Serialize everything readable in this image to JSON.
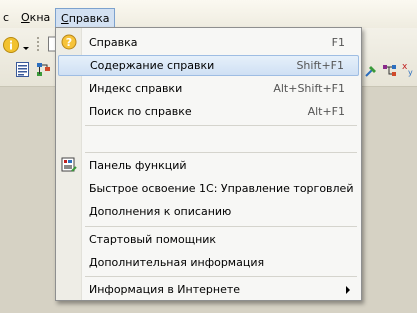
{
  "menubar": {
    "partial_item": "с",
    "okna_first": "О",
    "okna_rest": "кна",
    "help_first": "С",
    "help_rest": "правка"
  },
  "menu": {
    "items": [
      {
        "label": "Справка",
        "shortcut": "F1",
        "icon": "help-question-icon"
      },
      {
        "label": "Содержание справки",
        "shortcut": "Shift+F1",
        "highlighted": true
      },
      {
        "label": "Индекс справки",
        "shortcut": "Alt+Shift+F1"
      },
      {
        "label": "Поиск по справке",
        "shortcut": "Alt+F1"
      },
      {
        "label": "",
        "shortcut": ""
      },
      {
        "label": "Панель функций",
        "icon": "function-panel-icon"
      },
      {
        "label": "Быстрое освоение 1С: Управление торговлей"
      },
      {
        "label": "Дополнения к описанию"
      },
      {
        "label": "Стартовый помощник"
      },
      {
        "label": "Дополнительная информация"
      },
      {
        "label": "Информация в Интернете",
        "submenu": true
      }
    ]
  },
  "colors": {
    "highlight": "#cfe0f4",
    "highlight_border": "#9ebde3",
    "menu_bg": "#f7f7f5",
    "workspace": "#d6d2c4"
  }
}
